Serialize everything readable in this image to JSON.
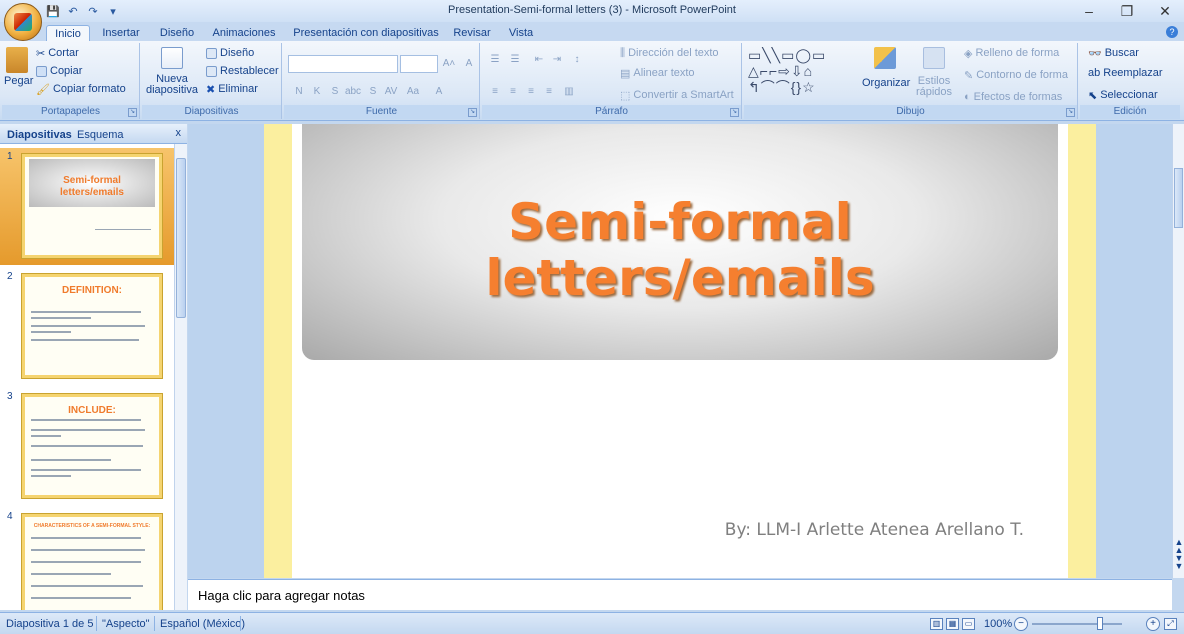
{
  "window": {
    "title": "Presentation-Semi-formal letters (3) - Microsoft PowerPoint",
    "controls": [
      "–",
      "❐",
      "✕"
    ]
  },
  "tabs": [
    {
      "label": "Inicio",
      "active": true
    },
    {
      "label": "Insertar"
    },
    {
      "label": "Diseño"
    },
    {
      "label": "Animaciones"
    },
    {
      "label": "Presentación con diapositivas"
    },
    {
      "label": "Revisar"
    },
    {
      "label": "Vista"
    }
  ],
  "ribbon": {
    "portapapeles": {
      "label": "Portapapeles",
      "pegar": "Pegar",
      "cortar": "Cortar",
      "copiar": "Copiar",
      "copiar_formato": "Copiar formato"
    },
    "diapositivas": {
      "label": "Diapositivas",
      "nueva_1": "Nueva",
      "nueva_2": "diapositiva",
      "diseno": "Diseño",
      "restablecer": "Restablecer",
      "eliminar": "Eliminar"
    },
    "fuente": {
      "label": "Fuente"
    },
    "parrafo": {
      "label": "Párrafo",
      "direccion": "Dirección del texto",
      "alinear": "Alinear texto",
      "convertir": "Convertir a SmartArt"
    },
    "dibujo": {
      "label": "Dibujo",
      "organizar": "Organizar",
      "estilos_1": "Estilos",
      "estilos_2": "rápidos",
      "relleno": "Relleno de forma",
      "contorno": "Contorno de forma",
      "efectos": "Efectos de formas"
    },
    "edicion": {
      "label": "Edición",
      "buscar": "Buscar",
      "reemplazar": "Reemplazar",
      "seleccionar": "Seleccionar"
    }
  },
  "panel": {
    "tab_diapositivas": "Diapositivas",
    "tab_esquema": "Esquema",
    "close": "x",
    "thumbs": [
      {
        "num": "1",
        "title_1": "Semi-formal",
        "title_2": "letters/emails"
      },
      {
        "num": "2",
        "title": "DEFINITION:"
      },
      {
        "num": "3",
        "title": "INCLUDE:"
      },
      {
        "num": "4",
        "title": "CHARACTERISTICS OF A SEMI-FORMAL STYLE:"
      }
    ]
  },
  "slide": {
    "title": "Semi-formal\nletters/emails",
    "subtitle": "By: LLM-I  Arlette Atenea Arellano T."
  },
  "notes": {
    "placeholder": "Haga clic para agregar notas"
  },
  "status": {
    "slide_count": "Diapositiva 1 de 5",
    "theme": "\"Aspecto\"",
    "language": "Español (México)",
    "zoom": "100%"
  }
}
